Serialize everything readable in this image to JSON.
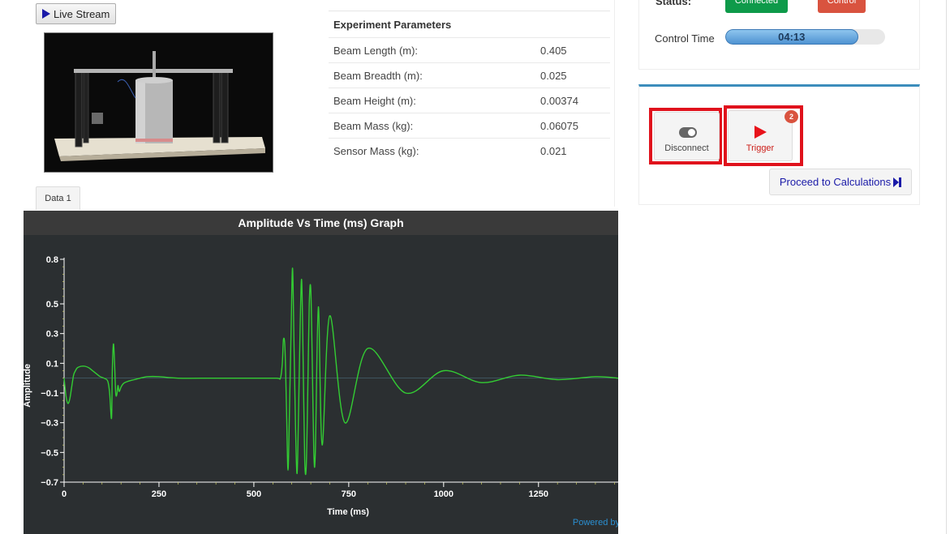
{
  "live_stream": {
    "label": "Live Stream"
  },
  "params": {
    "title": "Experiment Parameters",
    "rows": [
      {
        "key": "Beam Length (m):",
        "value": "0.405"
      },
      {
        "key": "Beam Breadth (m):",
        "value": "0.025"
      },
      {
        "key": "Beam Height (m):",
        "value": "0.00374"
      },
      {
        "key": "Beam Mass (kg):",
        "value": "0.06075"
      },
      {
        "key": "Sensor Mass (kg):",
        "value": "0.021"
      }
    ]
  },
  "data_tab": {
    "label": "Data 1"
  },
  "status": {
    "label": "Status:",
    "connected_label": "Connected",
    "control_label": "Control",
    "control_time_label": "Control Time",
    "control_time_value": "04:13",
    "control_time_fraction": 0.83,
    "colors": {
      "connected": "#0e9a4a",
      "control": "#d9533f",
      "progress": "#4f93d2"
    }
  },
  "actions": {
    "disconnect_label": "Disconnect",
    "trigger_label": "Trigger",
    "trigger_badge": "2",
    "proceed_label": "Proceed to Calculations"
  },
  "icons": {
    "live_stream": "play-icon",
    "disconnect": "toggle-icon",
    "trigger": "play-icon",
    "proceed": "step-forward-icon"
  },
  "chart": {
    "powered_by": "Powered by"
  },
  "chart_data": {
    "type": "line",
    "title": "Amplitude Vs Time (ms) Graph",
    "xlabel": "Time (ms)",
    "ylabel": "Amplitude",
    "xlim": [
      0,
      1460
    ],
    "ylim": [
      -0.7,
      0.8
    ],
    "x_ticks": [
      0,
      250,
      500,
      750,
      1000,
      1250
    ],
    "y_ticks": [
      0.8,
      0.5,
      0.3,
      0.1,
      -0.1,
      -0.3,
      -0.5,
      -0.7
    ],
    "grid": false,
    "line_color": "#33cc33",
    "series": [
      {
        "x": [
          0,
          5,
          10,
          15,
          20,
          25,
          30,
          35,
          45,
          55,
          65,
          75,
          85,
          95,
          105,
          115,
          120,
          125,
          127,
          130,
          133,
          136,
          139,
          142,
          145,
          150,
          155,
          160,
          170,
          185,
          200,
          220,
          250,
          300,
          400,
          500,
          560,
          570,
          575,
          578,
          582,
          586,
          590,
          594,
          598,
          602,
          606,
          610,
          614,
          618,
          622,
          626,
          630,
          634,
          638,
          642,
          646,
          650,
          654,
          658,
          662,
          670,
          680,
          700,
          740,
          800,
          900,
          1000,
          1100,
          1200,
          1300,
          1400,
          1460
        ],
        "y": [
          0.0,
          -0.12,
          -0.17,
          -0.14,
          -0.06,
          0.02,
          0.05,
          0.07,
          0.08,
          0.08,
          0.07,
          0.05,
          0.03,
          0.01,
          0.0,
          -0.02,
          -0.1,
          -0.27,
          0.05,
          0.23,
          0.1,
          -0.1,
          -0.11,
          -0.05,
          -0.09,
          -0.06,
          -0.04,
          -0.03,
          -0.02,
          -0.01,
          0.0,
          0.01,
          0.01,
          0.0,
          0.0,
          0.0,
          0.0,
          0.0,
          0.1,
          0.26,
          0.2,
          -0.2,
          -0.62,
          -0.2,
          0.3,
          0.74,
          0.2,
          -0.35,
          -0.64,
          -0.2,
          0.35,
          0.66,
          0.1,
          -0.55,
          -0.6,
          -0.1,
          0.5,
          0.6,
          0.1,
          -0.5,
          -0.5,
          0.48,
          -0.45,
          0.42,
          -0.3,
          0.2,
          -0.1,
          0.05,
          -0.03,
          0.02,
          -0.01,
          0.01,
          0.0
        ]
      }
    ]
  }
}
